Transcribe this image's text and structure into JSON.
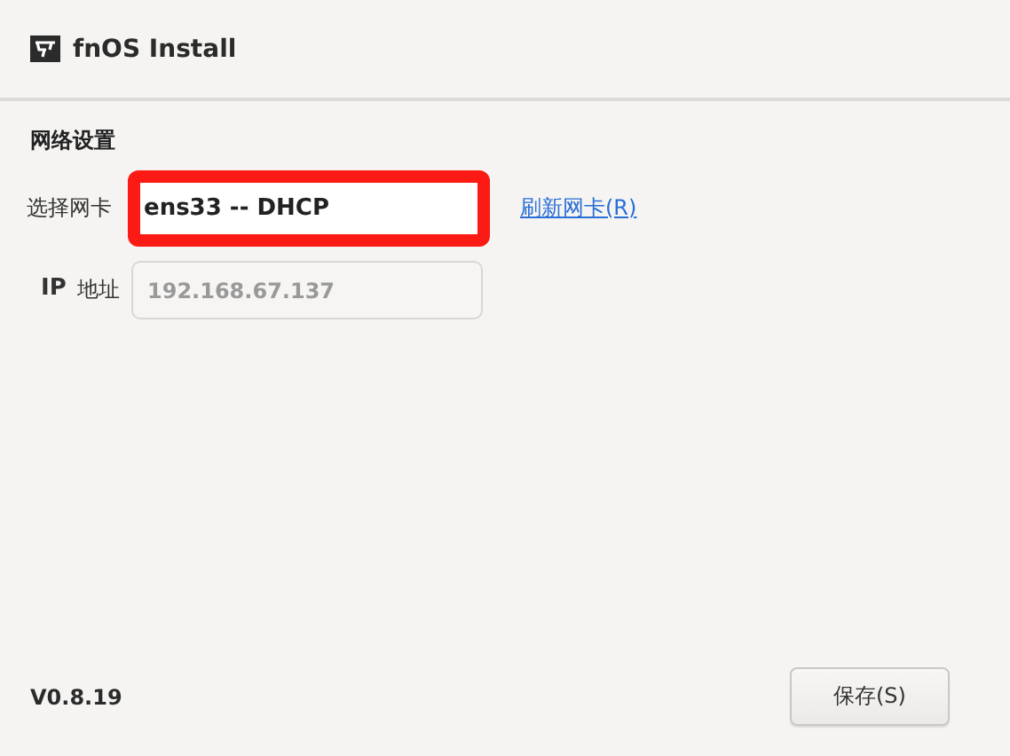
{
  "window": {
    "title": "fnOS Install"
  },
  "section": {
    "title": "网络设置"
  },
  "nic": {
    "label": "选择网卡",
    "value": "ens33 -- DHCP",
    "highlighted": true,
    "refresh_link": "刷新网卡(R)"
  },
  "ip": {
    "label_prefix": "IP",
    "label": "地址",
    "value": "192.168.67.137",
    "disabled": true
  },
  "footer": {
    "version": "V0.8.19",
    "save_button": "保存(S)"
  }
}
